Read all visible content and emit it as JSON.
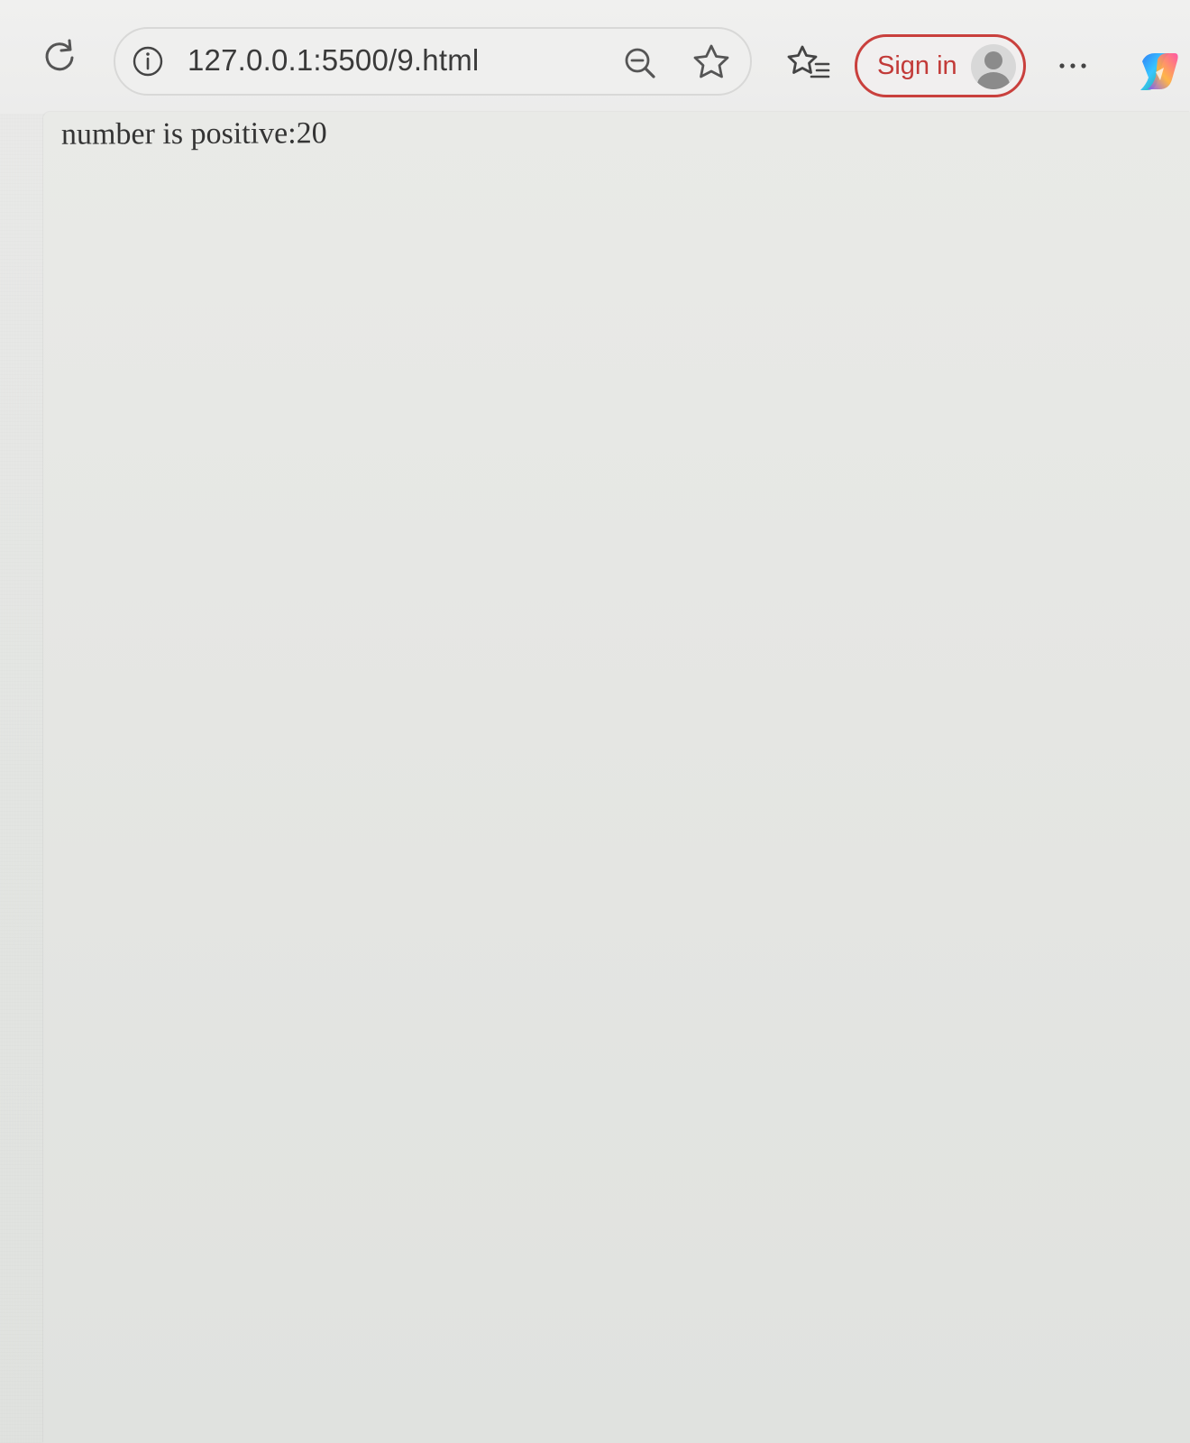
{
  "browser": {
    "url": "127.0.0.1:5500/9.html",
    "sign_in_label": "Sign in",
    "icons": {
      "reload": "reload-icon",
      "site_info": "info-icon",
      "zoom_out": "zoom-out-icon",
      "favorite": "star-icon",
      "favorites_menu": "favorites-list-icon",
      "more": "more-options-icon",
      "copilot": "copilot-icon"
    },
    "colors": {
      "sign_in_accent": "#c9403d"
    }
  },
  "page": {
    "message": "number is positive:20"
  }
}
